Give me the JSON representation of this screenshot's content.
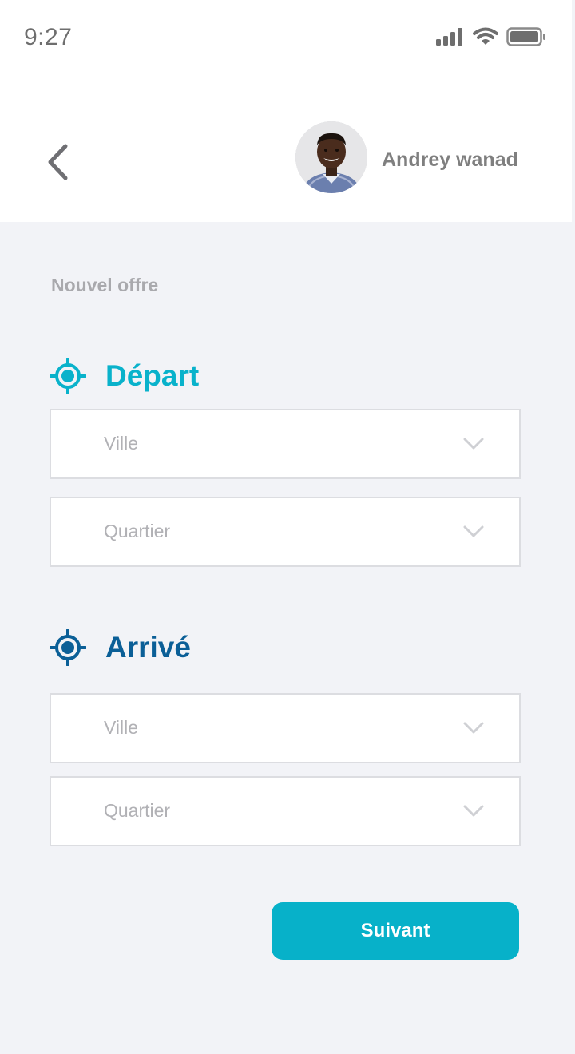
{
  "status_bar": {
    "time": "9:27",
    "icons": [
      "cellular-signal-icon",
      "wifi-icon",
      "battery-icon"
    ]
  },
  "header": {
    "back_icon": "chevron-left-icon",
    "user_name": "Andrey wanad"
  },
  "page": {
    "title": "Nouvel offre"
  },
  "departure": {
    "label": "Départ",
    "icon": "target-icon",
    "color": "#09b2cb",
    "city_placeholder": "Ville",
    "district_placeholder": "Quartier"
  },
  "arrival": {
    "label": "Arrivé",
    "icon": "target-icon",
    "color": "#0b5f97",
    "city_placeholder": "Ville",
    "district_placeholder": "Quartier"
  },
  "actions": {
    "next_label": "Suivant",
    "accent": "#07b1c9"
  }
}
